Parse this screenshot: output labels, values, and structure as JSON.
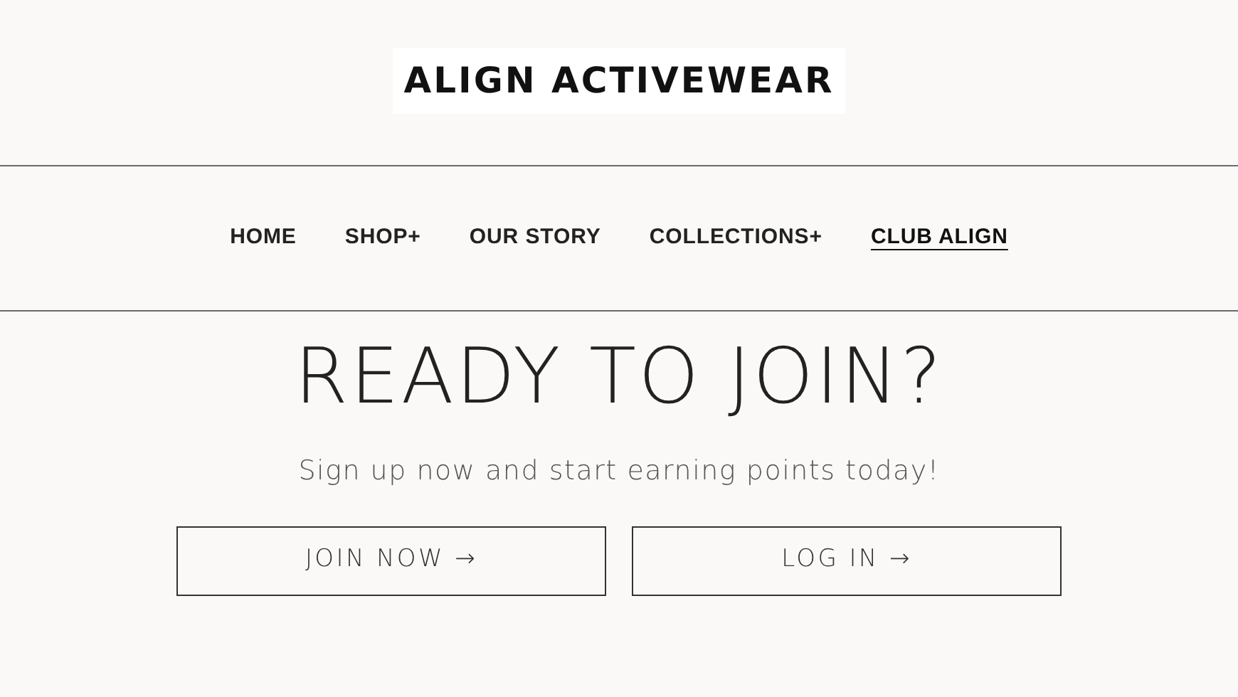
{
  "logo": "ALIGN ACTIVEWEAR",
  "nav": [
    {
      "label": "HOME",
      "selected": false
    },
    {
      "label": "SHOP+",
      "selected": false
    },
    {
      "label": "OUR STORY",
      "selected": false
    },
    {
      "label": "COLLECTIONS+",
      "selected": false
    },
    {
      "label": "CLUB ALIGN",
      "selected": true
    }
  ],
  "heading": "READY TO JOIN?",
  "subtitle": "Sign up now and start earning points today!",
  "buttons": [
    "JOIN NOW →",
    "LOG IN →"
  ]
}
